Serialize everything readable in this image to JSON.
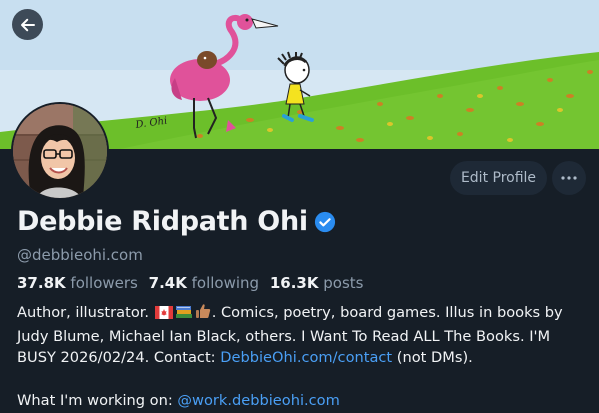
{
  "profile": {
    "name": "Debbie Ridpath Ohi",
    "handle": "@debbieohi.com",
    "banner_signature": "D. Ohi",
    "edit_button": "Edit Profile",
    "more_button": "···",
    "stats": {
      "followers_count": "37.8K",
      "followers_label": "followers",
      "following_count": "7.4K",
      "following_label": "following",
      "posts_count": "16.3K",
      "posts_label": "posts"
    },
    "bio": {
      "line1_a": "Author, illustrator. ",
      "line1_b": ". Comics, poetry, board games. Illus in books by Judy Blume, Michael Ian Black, others. I Want To Read ALL The Books. I'M BUSY 2026/02/24. Contact: ",
      "contact_link": "DebbieOhi.com/contact",
      "contact_tail": " (not DMs).",
      "working_label": "What I'm working on: ",
      "working_link": "@work.debbieohi.com"
    }
  },
  "icons": {
    "back": "arrow-left-icon",
    "verified": "verified-check-icon",
    "more": "more-horizontal-icon",
    "emoji": [
      "canadian-flag-icon",
      "books-icon",
      "thumbs-up-icon"
    ]
  },
  "colors": {
    "background": "#161e27",
    "link": "#4a9ff5",
    "verified": "#2a8cf0",
    "muted": "#8c9bab",
    "button_bg": "#1e2936"
  }
}
